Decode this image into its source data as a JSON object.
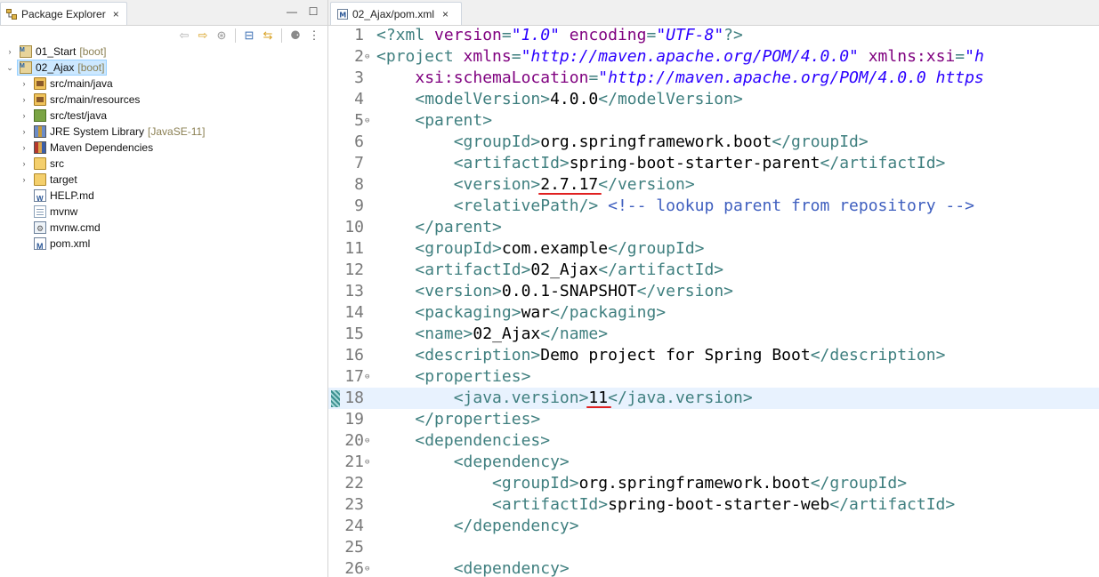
{
  "package_explorer": {
    "tab_label": "Package Explorer",
    "view_menu_icon": "view-menu-icon",
    "toolbar_icons": [
      "back-arrow-icon",
      "forward-arrow-icon",
      "sync-icon",
      "collapse-all-icon",
      "link-editor-icon",
      "focus-icon",
      "view-menu-icon"
    ],
    "tree": [
      {
        "label": "01_Start",
        "decoration": "[boot]",
        "icon": "maven-project-icon",
        "indent": 0,
        "twisty": "›",
        "selected": false
      },
      {
        "label": "02_Ajax",
        "decoration": "[boot]",
        "icon": "maven-project-icon",
        "indent": 0,
        "twisty": "⌄",
        "selected": true
      },
      {
        "label": "src/main/java",
        "decoration": "",
        "icon": "source-folder-icon",
        "indent": 1,
        "twisty": "›",
        "selected": false
      },
      {
        "label": "src/main/resources",
        "decoration": "",
        "icon": "source-folder-icon",
        "indent": 1,
        "twisty": "›",
        "selected": false
      },
      {
        "label": "src/test/java",
        "decoration": "",
        "icon": "test-source-folder-icon",
        "indent": 1,
        "twisty": "›",
        "selected": false
      },
      {
        "label": "JRE System Library",
        "decoration": "[JavaSE-11]",
        "icon": "library-icon",
        "indent": 1,
        "twisty": "›",
        "selected": false
      },
      {
        "label": "Maven Dependencies",
        "decoration": "",
        "icon": "maven-library-icon",
        "indent": 1,
        "twisty": "›",
        "selected": false
      },
      {
        "label": "src",
        "decoration": "",
        "icon": "folder-icon",
        "indent": 1,
        "twisty": "›",
        "selected": false
      },
      {
        "label": "target",
        "decoration": "",
        "icon": "folder-icon",
        "indent": 1,
        "twisty": "›",
        "selected": false
      },
      {
        "label": "HELP.md",
        "decoration": "",
        "icon": "markdown-file-icon",
        "indent": 1,
        "twisty": "",
        "selected": false
      },
      {
        "label": "mvnw",
        "decoration": "",
        "icon": "text-file-icon",
        "indent": 1,
        "twisty": "",
        "selected": false
      },
      {
        "label": "mvnw.cmd",
        "decoration": "",
        "icon": "cmd-file-icon",
        "indent": 1,
        "twisty": "",
        "selected": false
      },
      {
        "label": "pom.xml",
        "decoration": "",
        "icon": "maven-pom-icon",
        "indent": 1,
        "twisty": "",
        "selected": false
      }
    ]
  },
  "editor": {
    "tab_label": "02_Ajax/pom.xml",
    "close_glyph": "×",
    "current_line": 18,
    "lines": [
      {
        "n": "1",
        "fold": "",
        "parts": [
          [
            "t",
            "<?xml "
          ],
          [
            "a",
            "version"
          ],
          [
            "t",
            "="
          ],
          [
            "v",
            "\"1.0\""
          ],
          [
            "t",
            " "
          ],
          [
            "a",
            "encoding"
          ],
          [
            "t",
            "="
          ],
          [
            "v",
            "\"UTF-8\""
          ],
          [
            "t",
            "?>"
          ]
        ]
      },
      {
        "n": "2",
        "fold": "⊖",
        "parts": [
          [
            "t",
            "<project "
          ],
          [
            "a",
            "xmlns"
          ],
          [
            "t",
            "="
          ],
          [
            "v",
            "\"http://maven.apache.org/POM/4.0.0\""
          ],
          [
            "t",
            " "
          ],
          [
            "a",
            "xmlns:xsi"
          ],
          [
            "t",
            "="
          ],
          [
            "v",
            "\"h"
          ]
        ]
      },
      {
        "n": "3",
        "fold": "",
        "parts": [
          [
            "p",
            "    "
          ],
          [
            "a",
            "xsi:schemaLocation"
          ],
          [
            "t",
            "="
          ],
          [
            "v",
            "\"http://maven.apache.org/POM/4.0.0 https"
          ]
        ]
      },
      {
        "n": "4",
        "fold": "",
        "parts": [
          [
            "p",
            "    "
          ],
          [
            "t",
            "<modelVersion>"
          ],
          [
            "p",
            "4.0.0"
          ],
          [
            "t",
            "</modelVersion>"
          ]
        ]
      },
      {
        "n": "5",
        "fold": "⊖",
        "parts": [
          [
            "p",
            "    "
          ],
          [
            "t",
            "<parent>"
          ]
        ]
      },
      {
        "n": "6",
        "fold": "",
        "parts": [
          [
            "p",
            "        "
          ],
          [
            "t",
            "<groupId>"
          ],
          [
            "p",
            "org.springframework.boot"
          ],
          [
            "t",
            "</groupId>"
          ]
        ]
      },
      {
        "n": "7",
        "fold": "",
        "parts": [
          [
            "p",
            "        "
          ],
          [
            "t",
            "<artifactId>"
          ],
          [
            "p",
            "spring-boot-starter-parent"
          ],
          [
            "t",
            "</artifactId>"
          ]
        ]
      },
      {
        "n": "8",
        "fold": "",
        "parts": [
          [
            "p",
            "        "
          ],
          [
            "t",
            "<version>"
          ],
          [
            "p",
            "2.7.17"
          ],
          [
            "t",
            "</version>"
          ]
        ]
      },
      {
        "n": "9",
        "fold": "",
        "parts": [
          [
            "p",
            "        "
          ],
          [
            "t",
            "<relativePath/>"
          ],
          [
            "p",
            " "
          ],
          [
            "c",
            "<!-- lookup parent from repository -->"
          ]
        ]
      },
      {
        "n": "10",
        "fold": "",
        "parts": [
          [
            "p",
            "    "
          ],
          [
            "t",
            "</parent>"
          ]
        ]
      },
      {
        "n": "11",
        "fold": "",
        "parts": [
          [
            "p",
            "    "
          ],
          [
            "t",
            "<groupId>"
          ],
          [
            "p",
            "com.example"
          ],
          [
            "t",
            "</groupId>"
          ]
        ]
      },
      {
        "n": "12",
        "fold": "",
        "parts": [
          [
            "p",
            "    "
          ],
          [
            "t",
            "<artifactId>"
          ],
          [
            "p",
            "02_Ajax"
          ],
          [
            "t",
            "</artifactId>"
          ]
        ]
      },
      {
        "n": "13",
        "fold": "",
        "parts": [
          [
            "p",
            "    "
          ],
          [
            "t",
            "<version>"
          ],
          [
            "p",
            "0.0.1-SNAPSHOT"
          ],
          [
            "t",
            "</version>"
          ]
        ]
      },
      {
        "n": "14",
        "fold": "",
        "parts": [
          [
            "p",
            "    "
          ],
          [
            "t",
            "<packaging>"
          ],
          [
            "p",
            "war"
          ],
          [
            "t",
            "</packaging>"
          ]
        ]
      },
      {
        "n": "15",
        "fold": "",
        "parts": [
          [
            "p",
            "    "
          ],
          [
            "t",
            "<name>"
          ],
          [
            "p",
            "02_Ajax"
          ],
          [
            "t",
            "</name>"
          ]
        ]
      },
      {
        "n": "16",
        "fold": "",
        "parts": [
          [
            "p",
            "    "
          ],
          [
            "t",
            "<description>"
          ],
          [
            "p",
            "Demo project for Spring Boot"
          ],
          [
            "t",
            "</description>"
          ]
        ]
      },
      {
        "n": "17",
        "fold": "⊖",
        "parts": [
          [
            "p",
            "    "
          ],
          [
            "t",
            "<properties>"
          ]
        ]
      },
      {
        "n": "18",
        "fold": "",
        "parts": [
          [
            "p",
            "        "
          ],
          [
            "t",
            "<java.version>"
          ],
          [
            "p",
            "11"
          ],
          [
            "t",
            "</java.version>"
          ]
        ]
      },
      {
        "n": "19",
        "fold": "",
        "parts": [
          [
            "p",
            "    "
          ],
          [
            "t",
            "</properties>"
          ]
        ]
      },
      {
        "n": "20",
        "fold": "⊖",
        "parts": [
          [
            "p",
            "    "
          ],
          [
            "t",
            "<dependencies>"
          ]
        ]
      },
      {
        "n": "21",
        "fold": "⊖",
        "parts": [
          [
            "p",
            "        "
          ],
          [
            "t",
            "<dependency>"
          ]
        ]
      },
      {
        "n": "22",
        "fold": "",
        "parts": [
          [
            "p",
            "            "
          ],
          [
            "t",
            "<groupId>"
          ],
          [
            "p",
            "org.springframework.boot"
          ],
          [
            "t",
            "</groupId>"
          ]
        ]
      },
      {
        "n": "23",
        "fold": "",
        "parts": [
          [
            "p",
            "            "
          ],
          [
            "t",
            "<artifactId>"
          ],
          [
            "p",
            "spring-boot-starter-web"
          ],
          [
            "t",
            "</artifactId>"
          ]
        ]
      },
      {
        "n": "24",
        "fold": "",
        "parts": [
          [
            "p",
            "        "
          ],
          [
            "t",
            "</dependency>"
          ]
        ]
      },
      {
        "n": "25",
        "fold": "",
        "parts": []
      },
      {
        "n": "26",
        "fold": "⊖",
        "parts": [
          [
            "p",
            "        "
          ],
          [
            "t",
            "<dependency>"
          ]
        ]
      }
    ],
    "annotations": [
      {
        "line": 8,
        "target": "2.7.17",
        "color": "#e02020"
      },
      {
        "line": 18,
        "target": "11",
        "color": "#e02020"
      }
    ]
  }
}
